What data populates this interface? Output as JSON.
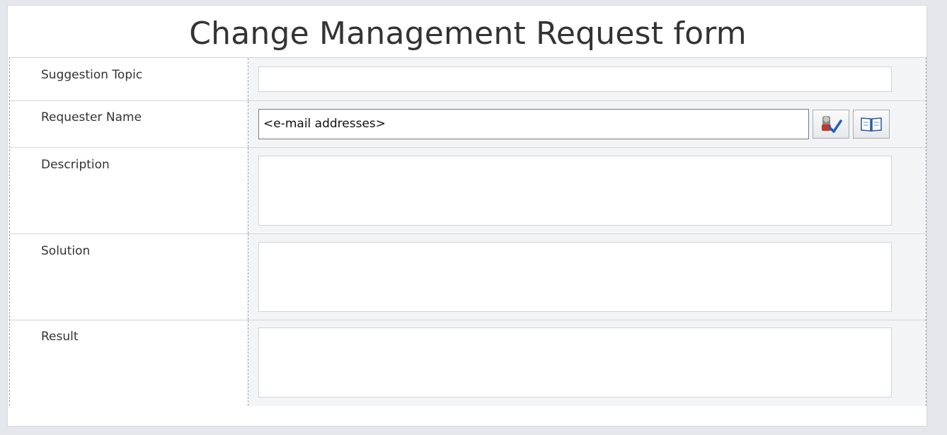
{
  "form": {
    "title": "Change Management Request form",
    "fields": [
      {
        "label": "Suggestion Topic",
        "value": ""
      },
      {
        "label": "Requester Name",
        "placeholder": "<e-mail addresses>"
      },
      {
        "label": "Description",
        "value": ""
      },
      {
        "label": "Solution",
        "value": ""
      },
      {
        "label": "Result",
        "value": ""
      }
    ],
    "icons": {
      "check_names": "check-names-icon",
      "address_book": "address-book-icon"
    }
  }
}
